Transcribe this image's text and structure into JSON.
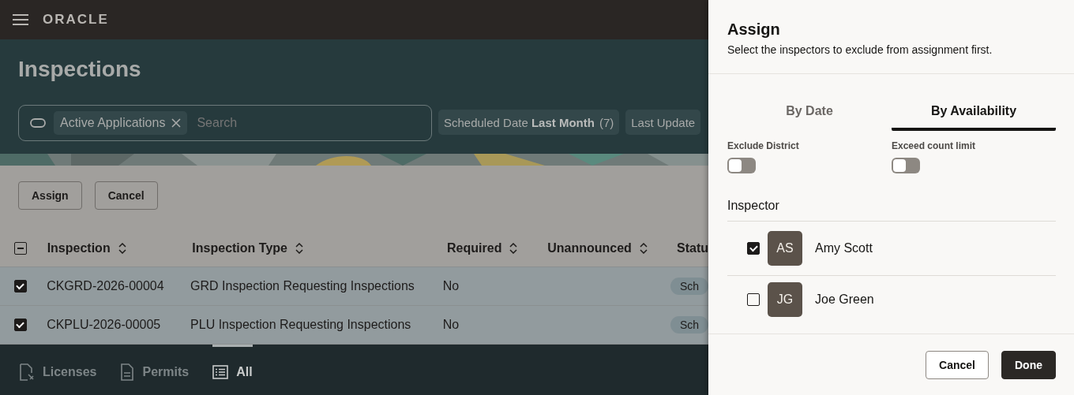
{
  "header": {
    "logo": "ORACLE"
  },
  "page": {
    "title": "Inspections"
  },
  "search": {
    "chips": [
      {
        "label": "Active Applications"
      }
    ],
    "placeholder": "Search"
  },
  "filters": [
    {
      "label": "Scheduled Date **Last Month**",
      "count": "(7)"
    },
    {
      "label": "Last Update"
    }
  ],
  "actions": [
    "Assign",
    "Cancel"
  ],
  "table": {
    "select_all_partial": true,
    "columns": [
      "Inspection",
      "Inspection Type",
      "Required",
      "Unannounced",
      "Statu"
    ],
    "rows": [
      {
        "checked": true,
        "cells": [
          "CKGRD-2026-00004",
          "GRD Inspection Requesting Inspections",
          "No",
          "",
          "Sch"
        ]
      },
      {
        "checked": true,
        "cells": [
          "CKPLU-2026-00005",
          "PLU Inspection Requesting Inspections",
          "No",
          "",
          "Sch"
        ]
      }
    ]
  },
  "bottom_nav": [
    {
      "label": "Licenses",
      "selected": false
    },
    {
      "label": "Permits",
      "selected": false
    },
    {
      "label": "All",
      "selected": true
    }
  ],
  "drawer": {
    "title": "Assign",
    "subtitle": "Select the inspectors to exclude from assignment first.",
    "tabs": [
      {
        "label": "By Date",
        "selected": false
      },
      {
        "label": "By Availability",
        "selected": true
      }
    ],
    "toggles": [
      {
        "label": "Exclude District",
        "on": false
      },
      {
        "label": "Exceed count limit",
        "on": false
      }
    ],
    "list_header": "Inspector",
    "inspectors": [
      {
        "initials": "AS",
        "name": "Amy Scott",
        "checked": true
      },
      {
        "initials": "JG",
        "name": "Joe Green",
        "checked": false
      }
    ],
    "buttons": [
      {
        "label": "Cancel",
        "kind": "secondary"
      },
      {
        "label": "Done",
        "kind": "primary"
      }
    ]
  }
}
